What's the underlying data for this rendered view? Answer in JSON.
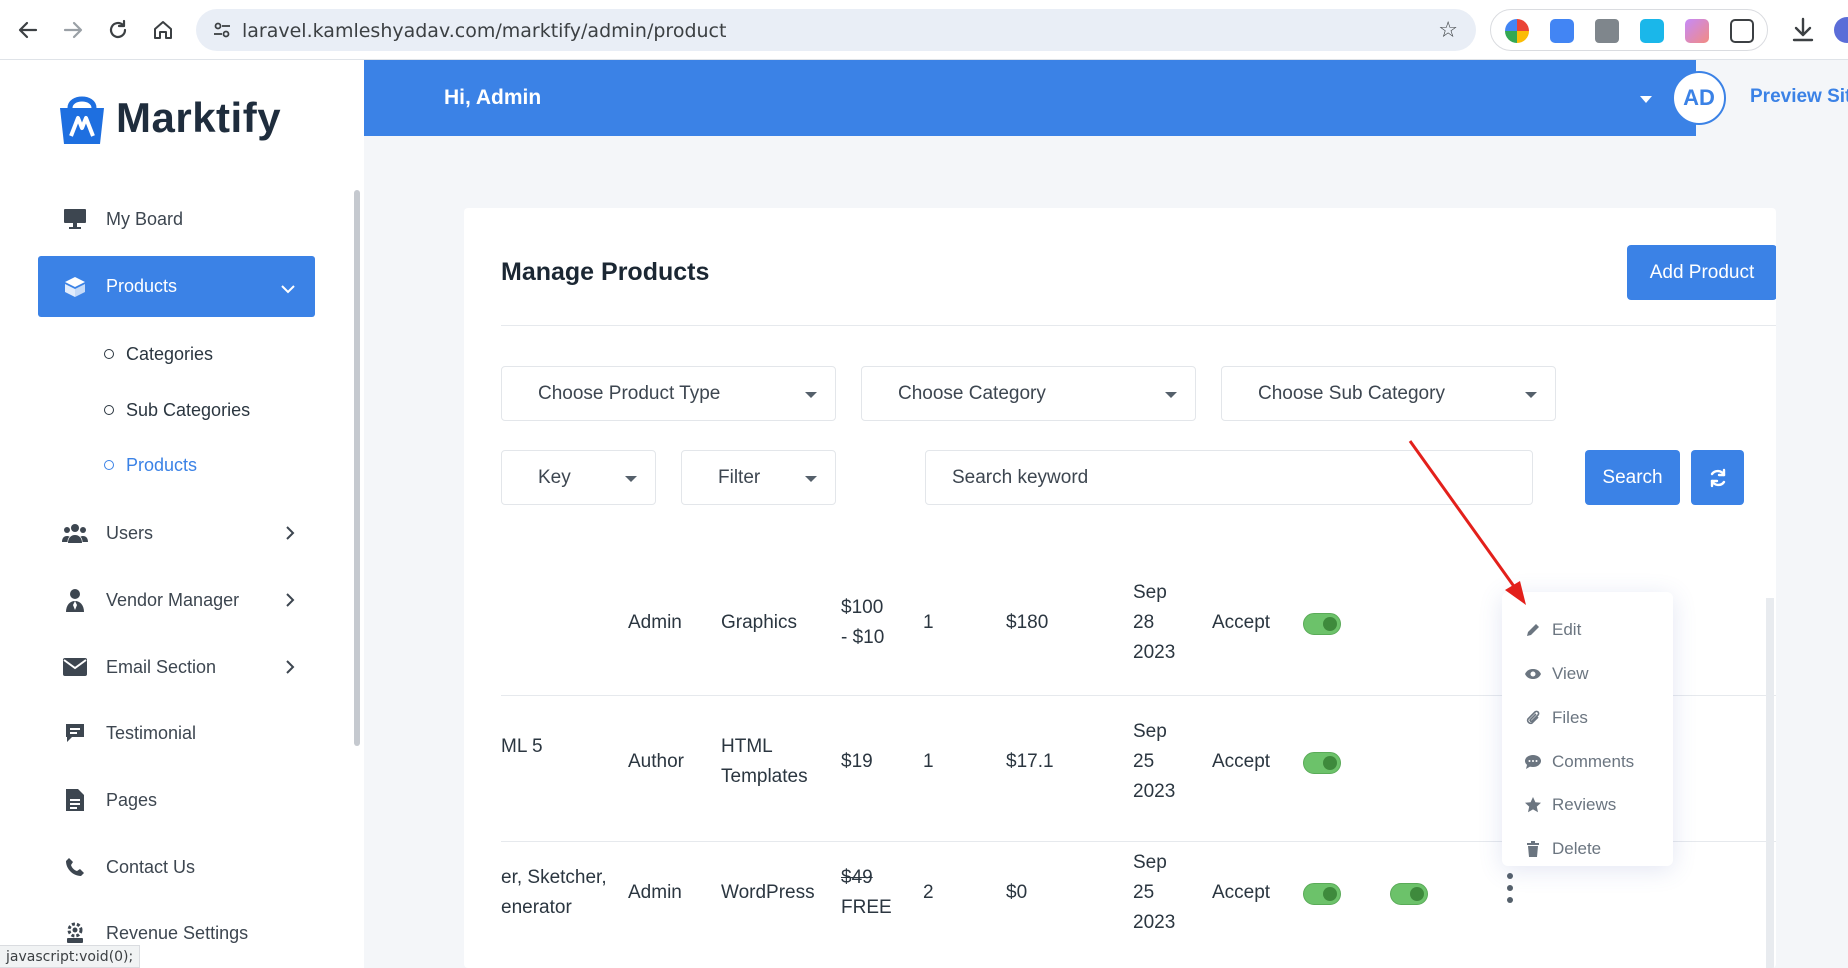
{
  "browser": {
    "url": "laravel.kamleshyadav.com/marktify/admin/product",
    "status_text": "javascript:void(0);"
  },
  "brand": {
    "name": "Marktify"
  },
  "sidebar": {
    "items": [
      {
        "label": "My Board",
        "icon": "monitor-icon"
      },
      {
        "label": "Products",
        "icon": "box-icon"
      },
      {
        "label": "Users",
        "icon": "users-icon"
      },
      {
        "label": "Vendor Manager",
        "icon": "vendor-icon"
      },
      {
        "label": "Email Section",
        "icon": "envelope-icon"
      },
      {
        "label": "Testimonial",
        "icon": "comment-icon"
      },
      {
        "label": "Pages",
        "icon": "document-icon"
      },
      {
        "label": "Contact Us",
        "icon": "phone-icon"
      },
      {
        "label": "Revenue Settings",
        "icon": "settings-icon"
      }
    ],
    "sub_items": [
      {
        "label": "Categories"
      },
      {
        "label": "Sub Categories"
      },
      {
        "label": "Products"
      }
    ]
  },
  "header": {
    "greeting": "Hi, Admin",
    "avatar_initials": "AD",
    "preview_link": "Preview Site"
  },
  "main": {
    "title": "Manage Products",
    "add_button": "Add Product",
    "filters": {
      "product_type": "Choose Product Type",
      "category": "Choose Category",
      "sub_category": "Choose Sub Category",
      "key": "Key",
      "filter": "Filter",
      "search_placeholder": "Search keyword",
      "search_button": "Search"
    },
    "rows": [
      {
        "name_1": "",
        "name_2": "",
        "author": "Admin",
        "category_1": "Graphics",
        "category_2": "",
        "price_1": "$100",
        "price_2": "- $10",
        "qty": "1",
        "earning": "$180",
        "date_1": "Sep",
        "date_2": "28",
        "date_3": "2023",
        "status": "Accept"
      },
      {
        "name_1": "ML 5",
        "name_2": "",
        "author": "Author",
        "category_1": "HTML",
        "category_2": "Templates",
        "price_1": "$19",
        "price_2": "",
        "qty": "1",
        "earning": "$17.1",
        "date_1": "Sep",
        "date_2": "25",
        "date_3": "2023",
        "status": "Accept"
      },
      {
        "name_1": "er, Sketcher,",
        "name_2": "enerator",
        "author": "Admin",
        "category_1": "WordPress",
        "category_2": "",
        "price_1": "$49",
        "price_2": "FREE",
        "qty": "2",
        "earning": "$0",
        "date_1": "Sep",
        "date_2": "25",
        "date_3": "2023",
        "status": "Accept"
      }
    ],
    "action_menu": [
      {
        "label": "Edit",
        "icon": "pencil-icon"
      },
      {
        "label": "View",
        "icon": "eye-icon"
      },
      {
        "label": "Files",
        "icon": "paperclip-icon"
      },
      {
        "label": "Comments",
        "icon": "comments-icon"
      },
      {
        "label": "Reviews",
        "icon": "star-icon"
      },
      {
        "label": "Delete",
        "icon": "trash-icon"
      }
    ]
  },
  "colors": {
    "primary": "#3b82e6",
    "toggle_on": "#6cc26a",
    "annotation_arrow": "#e3201b"
  }
}
